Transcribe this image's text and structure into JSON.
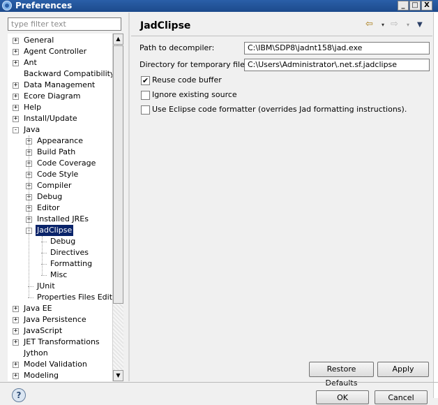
{
  "window": {
    "title": "Preferences",
    "minimize": "_",
    "maximize": "□",
    "close": "X"
  },
  "filter": {
    "placeholder": "type filter text"
  },
  "tree": {
    "items": [
      {
        "label": "General",
        "expander": "+"
      },
      {
        "label": "Agent Controller",
        "expander": "+"
      },
      {
        "label": "Ant",
        "expander": "+"
      },
      {
        "label": "Backward Compatibility",
        "expander": ""
      },
      {
        "label": "Data Management",
        "expander": "+"
      },
      {
        "label": "Ecore Diagram",
        "expander": "+"
      },
      {
        "label": "Help",
        "expander": "+"
      },
      {
        "label": "Install/Update",
        "expander": "+"
      },
      {
        "label": "Java",
        "expander": "-"
      },
      {
        "label": "Appearance",
        "expander": "+"
      },
      {
        "label": "Build Path",
        "expander": "+"
      },
      {
        "label": "Code Coverage",
        "expander": "+"
      },
      {
        "label": "Code Style",
        "expander": "+"
      },
      {
        "label": "Compiler",
        "expander": "+"
      },
      {
        "label": "Debug",
        "expander": "+"
      },
      {
        "label": "Editor",
        "expander": "+"
      },
      {
        "label": "Installed JREs",
        "expander": "+"
      },
      {
        "label": "JadClipse",
        "expander": "-"
      },
      {
        "label": "Debug",
        "expander": ""
      },
      {
        "label": "Directives",
        "expander": ""
      },
      {
        "label": "Formatting",
        "expander": ""
      },
      {
        "label": "Misc",
        "expander": ""
      },
      {
        "label": "JUnit",
        "expander": ""
      },
      {
        "label": "Properties Files Editor",
        "expander": ""
      },
      {
        "label": "Java EE",
        "expander": "+"
      },
      {
        "label": "Java Persistence",
        "expander": "+"
      },
      {
        "label": "JavaScript",
        "expander": "+"
      },
      {
        "label": "JET Transformations",
        "expander": "+"
      },
      {
        "label": "Jython",
        "expander": ""
      },
      {
        "label": "Model Validation",
        "expander": "+"
      },
      {
        "label": "Modeling",
        "expander": "+"
      }
    ]
  },
  "page": {
    "title": "JadClipse",
    "back_icon": "⇦",
    "forward_icon": "⇨",
    "menu_icon": "▼",
    "dropdown_icon": "▾"
  },
  "form": {
    "decompiler_label": "Path to decompiler:",
    "decompiler_value": "C:\\IBM\\SDP8\\jadnt158\\jad.exe",
    "tempdir_label": "Directory for temporary files:",
    "tempdir_value": "C:\\Users\\Administrator\\.net.sf.jadclipse",
    "reuse_label": "Reuse code buffer",
    "ignore_label": "Ignore existing source",
    "formatter_label": "Use Eclipse code formatter (overrides Jad formatting instructions).",
    "check_mark": "✔"
  },
  "buttons": {
    "restore_defaults": "Restore Defaults",
    "apply": "Apply",
    "ok": "OK",
    "cancel": "Cancel",
    "help": "?"
  }
}
